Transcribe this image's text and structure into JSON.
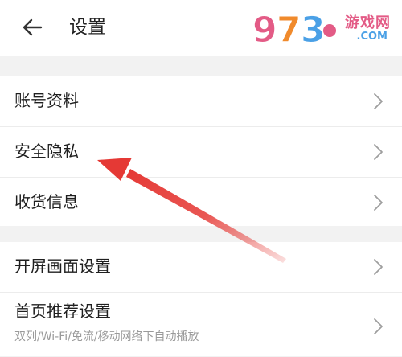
{
  "header": {
    "title": "设置",
    "back_icon": "arrow-left-icon"
  },
  "watermark": {
    "logo_text": "9 7 3",
    "brand": "游戏网",
    "domain": ".COM",
    "color_pink": "#e35b86",
    "color_blue": "#4aa0e6"
  },
  "sections": [
    {
      "items": [
        {
          "label": "账号资料"
        },
        {
          "label": "安全隐私"
        },
        {
          "label": "收货信息"
        }
      ]
    },
    {
      "items": [
        {
          "label": "开屏画面设置"
        },
        {
          "label": "首页推荐设置",
          "subtitle": "双列/Wi-Fi/免流/移动网络下自动播放"
        }
      ]
    }
  ],
  "annotation": {
    "type": "red-arrow",
    "color": "#e53935",
    "points_to": "安全隐私"
  }
}
